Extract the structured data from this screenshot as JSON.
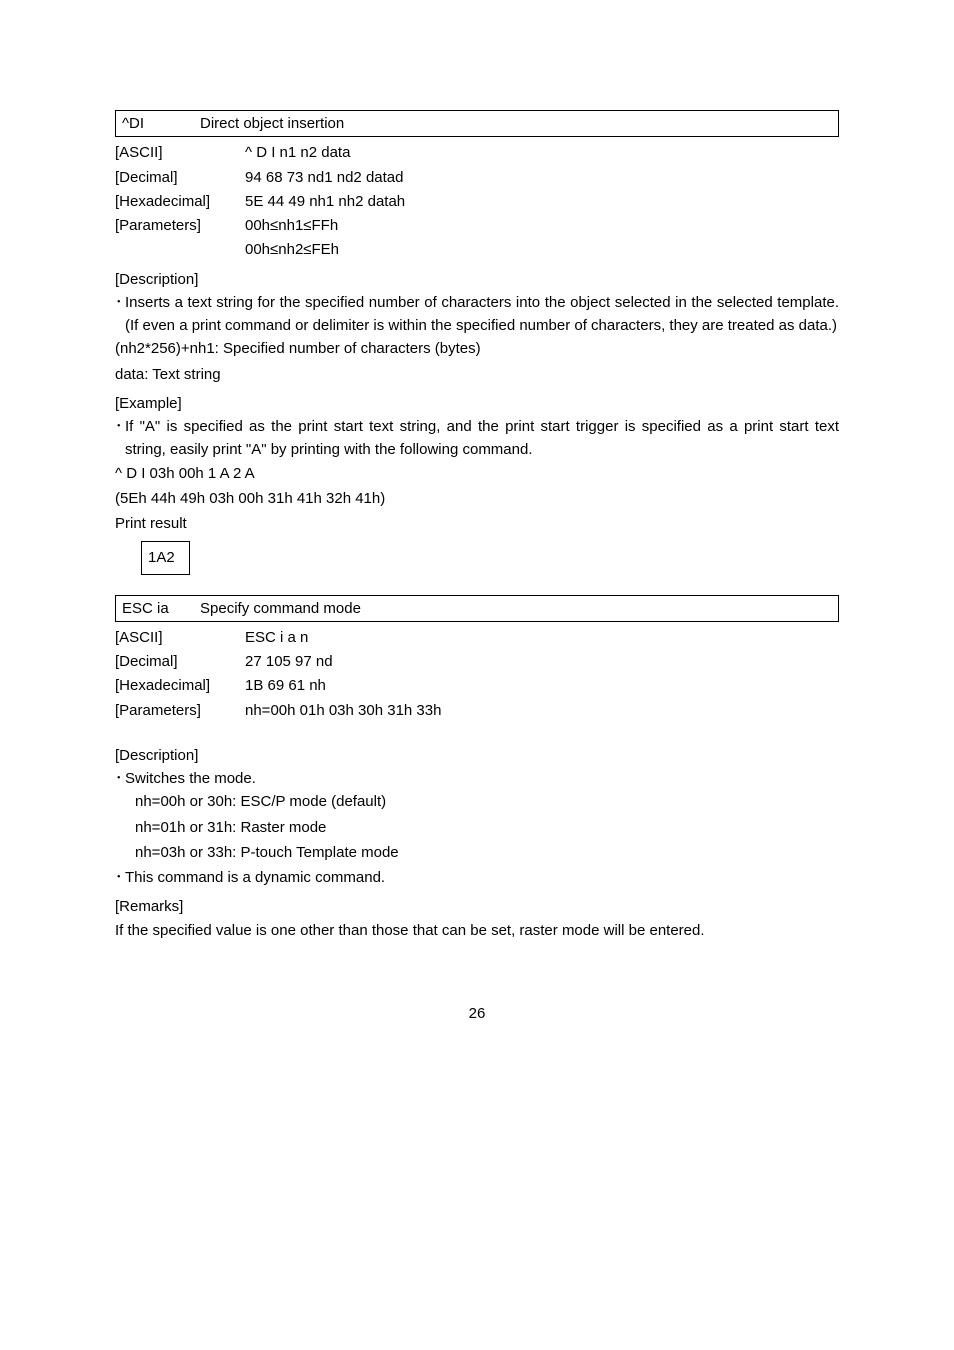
{
  "cmd1": {
    "code": "^DI",
    "title": "Direct object insertion",
    "rows": [
      {
        "label": "[ASCII]",
        "value": "^ D I n1 n2 data"
      },
      {
        "label": "[Decimal]",
        "value": "94 68 73 nd1 nd2 datad"
      },
      {
        "label": "[Hexadecimal]",
        "value": "5E 44 49 nh1 nh2 datah"
      },
      {
        "label": "[Parameters]",
        "value": "00h≤nh1≤FFh"
      },
      {
        "label": "",
        "value": "00h≤nh2≤FEh"
      }
    ],
    "desc_label": "[Description]",
    "desc": "Inserts a text string for the specified number of characters into the object selected in the selected template. (If even a print command or delimiter is within the specified number of characters, they are treated as data.)",
    "desc_extra1": "(nh2*256)+nh1: Specified number of characters (bytes)",
    "desc_extra2": "data: Text string",
    "example_label": "[Example]",
    "example": "If \"A\" is specified as the print start text string, and the print start trigger is specified as a print start text string, easily print \"A\" by printing with the following command.",
    "example_line1": "^ D I 03h 00h 1 A 2 A",
    "example_line2": "(5Eh 44h 49h 03h 00h 31h 41h 32h 41h)",
    "example_line3": "Print result",
    "example_box": "1A2"
  },
  "cmd2": {
    "code": "ESC ia",
    "title": "Specify command mode",
    "rows": [
      {
        "label": "[ASCII]",
        "value": "ESC i a n"
      },
      {
        "label": "[Decimal]",
        "value": "27 105 97 nd"
      },
      {
        "label": "[Hexadecimal]",
        "value": "1B 69 61 nh"
      },
      {
        "label": "[Parameters]",
        "value": "nh=00h 01h 03h 30h 31h 33h"
      }
    ],
    "desc_label": "[Description]",
    "switch": "Switches the mode.",
    "mode1": "nh=00h or 30h: ESC/P mode (default)",
    "mode2": "nh=01h or 31h: Raster mode",
    "mode3": "nh=03h or 33h: P-touch Template mode",
    "dyn": "This command is a dynamic command.",
    "remarks_label": "[Remarks]",
    "remarks": "If the specified value is one other than those that can be set, raster mode will be entered."
  },
  "page_number": "26"
}
